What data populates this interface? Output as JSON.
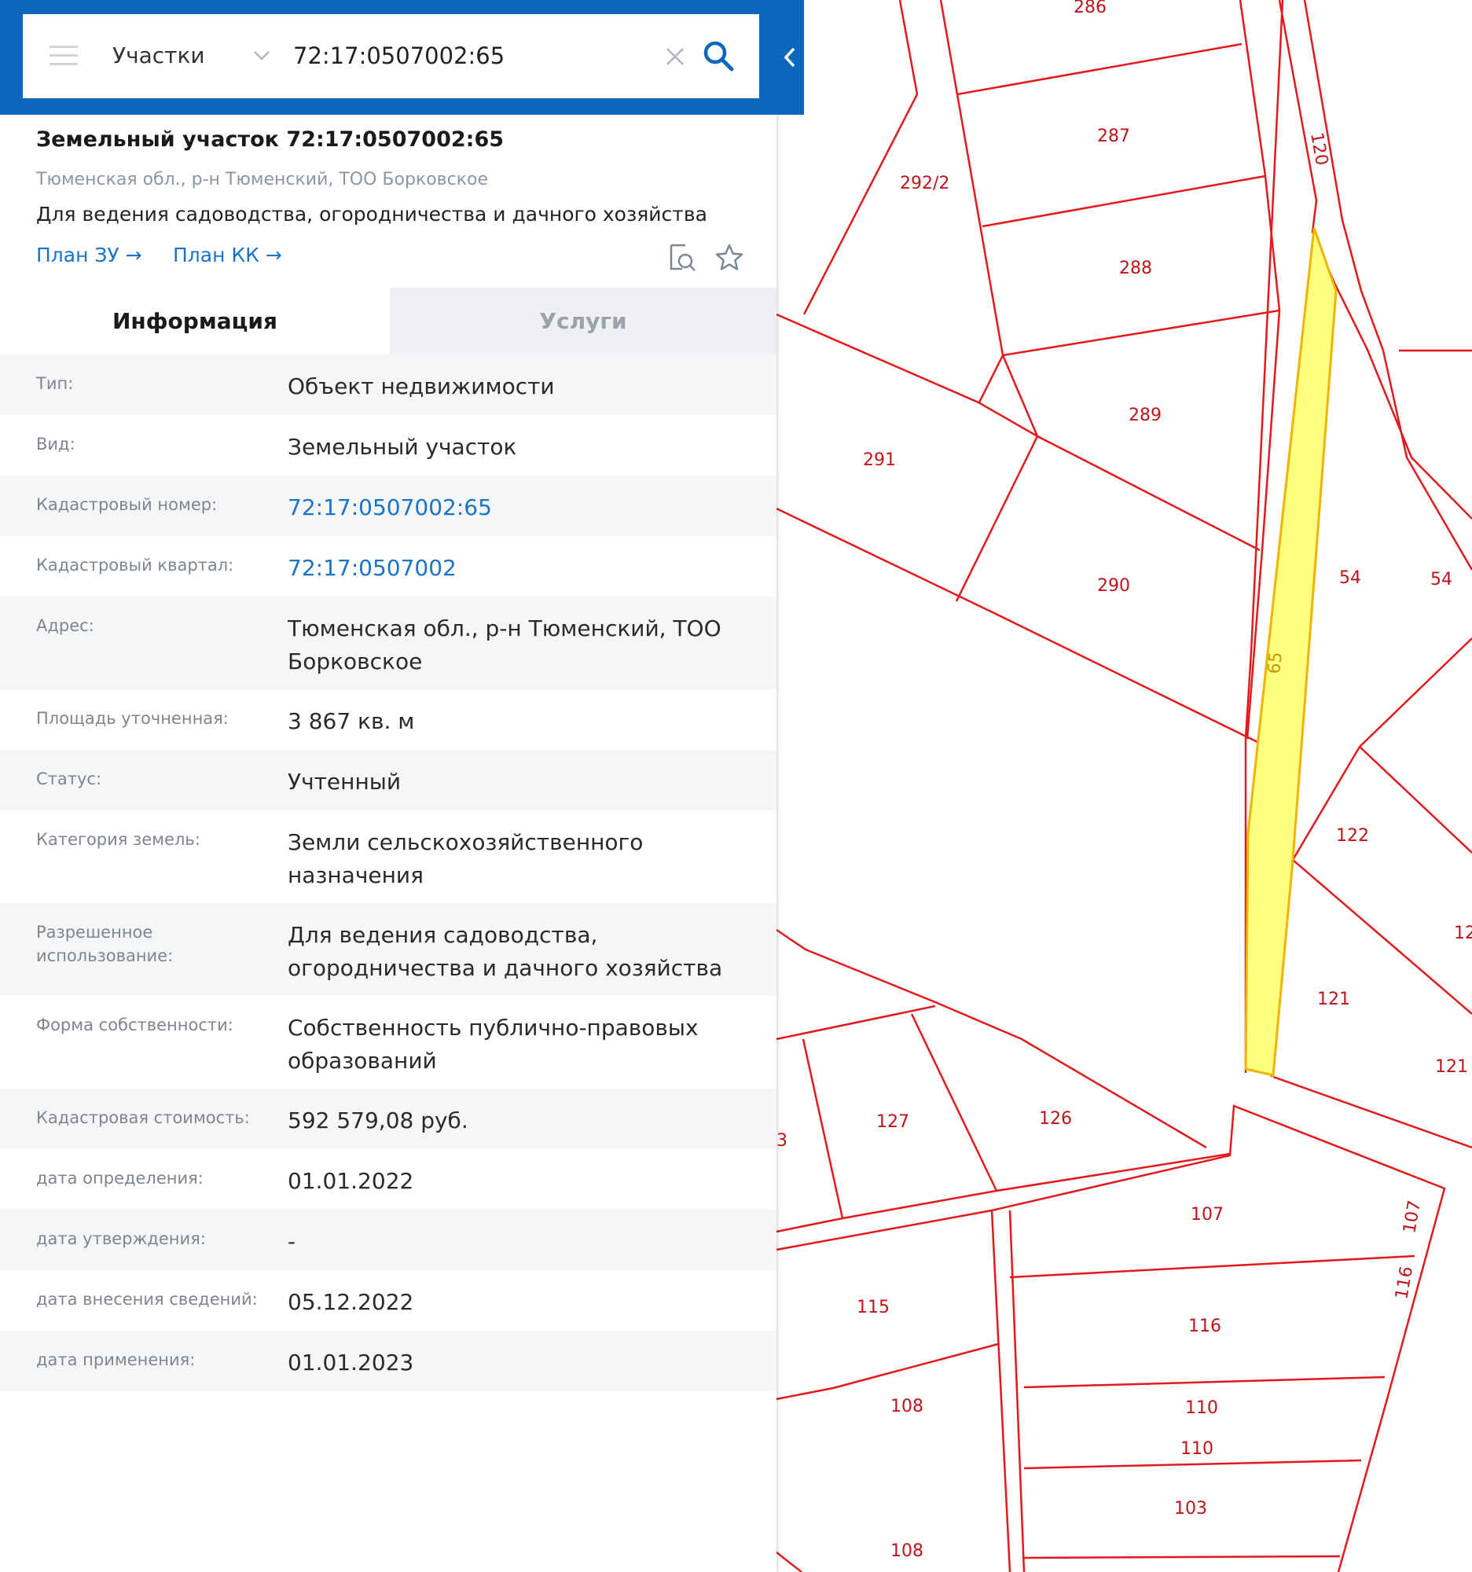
{
  "search": {
    "category": "Участки",
    "query": "72:17:0507002:65"
  },
  "card": {
    "title": "Земельный участок 72:17:0507002:65",
    "address": "Тюменская обл., р-н Тюменский, ТОО Борковское",
    "use": "Для ведения садоводства, огородничества и дачного хозяйства",
    "link_plan_zu": "План ЗУ →",
    "link_plan_kk": "План КК →"
  },
  "tabs": {
    "info": "Информация",
    "services": "Услуги"
  },
  "info": {
    "type_label": "Тип:",
    "type_value": "Объект недвижимости",
    "kind_label": "Вид:",
    "kind_value": "Земельный участок",
    "cadnum_label": "Кадастровый номер:",
    "cadnum_value": "72:17:0507002:65",
    "quarter_label": "Кадастровый квартал:",
    "quarter_value": "72:17:0507002",
    "address_label": "Адрес:",
    "address_value": "Тюменская обл., р-н Тюменский, ТОО Борковское",
    "area_label": "Площадь уточненная:",
    "area_value": "3 867 кв. м",
    "status_label": "Статус:",
    "status_value": "Учтенный",
    "category_label": "Категория земель:",
    "category_value": "Земли сельскохозяйственного назначения",
    "permitted_label": "Разрешенное использование:",
    "permitted_value": "Для ведения садоводства, огородничества и дачного хозяйства",
    "ownership_label": "Форма собственности:",
    "ownership_value": "Собственность публично-правовых образований",
    "cost_label": "Кадастровая стоимость:",
    "cost_value": "592 579,08 руб.",
    "date_def_label": "дата определения:",
    "date_def_value": "01.01.2022",
    "date_appr_label": "дата утверждения:",
    "date_appr_value": "-",
    "date_entry_label": "дата внесения сведений:",
    "date_entry_value": "05.12.2022",
    "date_apply_label": "дата применения:",
    "date_apply_value": "01.01.2023"
  },
  "map": {
    "parcel_labels": {
      "p286": "286",
      "p287": "287",
      "p288": "288",
      "p289": "289",
      "p290": "290",
      "p291": "291",
      "p292_2": "292/2",
      "p120": "120",
      "p54a": "54",
      "p54b": "54",
      "p65": "65",
      "p122": "122",
      "p12x": "12",
      "p121a": "121",
      "p121b": "121",
      "p127": "127",
      "p126": "126",
      "p3": "3",
      "p107a": "107",
      "p107b": "107",
      "p116a": "116",
      "p116b": "116",
      "p115": "115",
      "p108a": "108",
      "p108b": "108",
      "p110a": "110",
      "p110b": "110",
      "p103": "103"
    },
    "colors": {
      "boundary": "#e31a1c",
      "label": "#c0141a",
      "selected_fill": "#ffff80",
      "selected_stroke": "#f0b400",
      "selected_label": "#c89a00"
    }
  }
}
